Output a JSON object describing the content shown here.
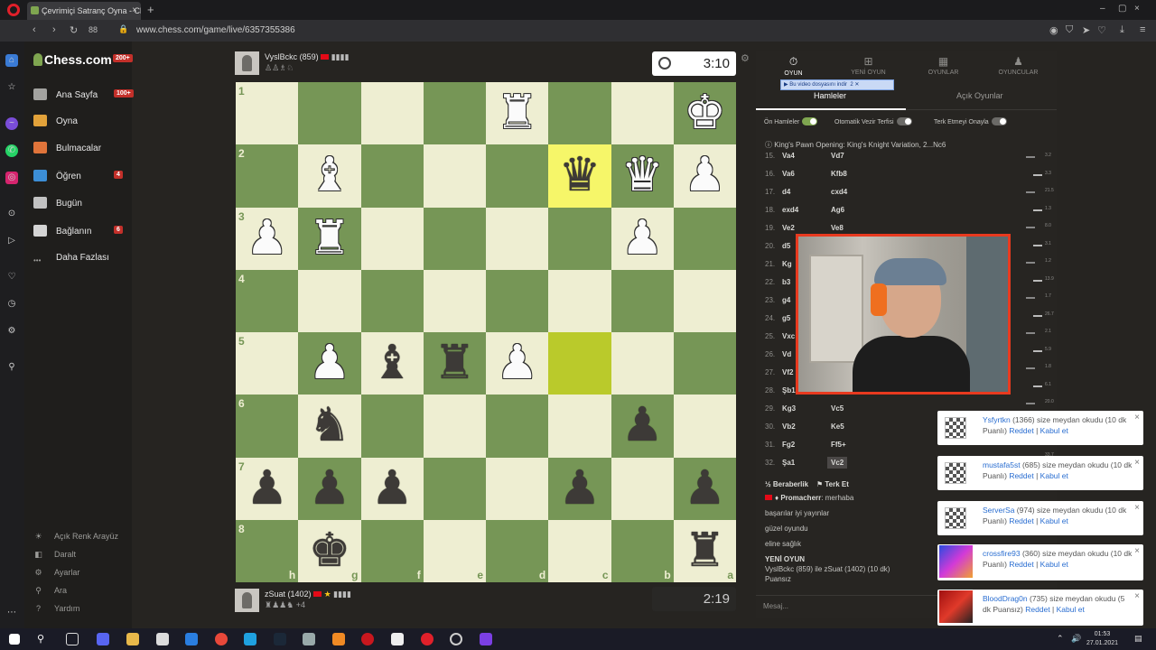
{
  "browser": {
    "tab_title": "Çevrimiçi Satranç Oyna - Ch",
    "tab_close": "×",
    "new_tab": "+",
    "url": "www.chess.com/game/live/6357355386",
    "speed_dial_count": "88",
    "window_controls": [
      "–",
      "▢",
      "×"
    ]
  },
  "sidebar": {
    "logo": "Chess.com",
    "logo_badge": "200+",
    "items": [
      {
        "label": "Ana Sayfa",
        "badge": "100+",
        "icon": "home-icon",
        "color": "#a3a3a0"
      },
      {
        "label": "Oyna",
        "badge": "",
        "icon": "pawn-play-icon",
        "color": "#e2a23a"
      },
      {
        "label": "Bulmacalar",
        "badge": "",
        "icon": "puzzle-icon",
        "color": "#e0743a"
      },
      {
        "label": "Öğren",
        "badge": "4",
        "icon": "learn-icon",
        "color": "#3c8ed6"
      },
      {
        "label": "Bugün",
        "badge": "",
        "icon": "news-icon",
        "color": "#c2c2c2"
      },
      {
        "label": "Bağlanın",
        "badge": "6",
        "icon": "community-icon",
        "color": "#d4d4d4"
      },
      {
        "label": "Daha Fazlası",
        "badge": "",
        "icon": "more-dots-icon",
        "color": "#9b9b98"
      }
    ],
    "bottom": [
      {
        "label": "Açık Renk Arayüz",
        "icon": "sun-icon",
        "glyph": "☀"
      },
      {
        "label": "Daralt",
        "icon": "collapse-icon",
        "glyph": "◧"
      },
      {
        "label": "Ayarlar",
        "icon": "settings-icon",
        "glyph": "⚙"
      },
      {
        "label": "Ara",
        "icon": "search-icon",
        "glyph": "⚲"
      },
      {
        "label": "Yardım",
        "icon": "help-icon",
        "glyph": "?"
      }
    ]
  },
  "top_player": {
    "name": "VyslBckc (859)",
    "clock": "3:10"
  },
  "bottom_player": {
    "name": "zSuat (1402)",
    "sub": "+4",
    "clock": "2:19"
  },
  "board": {
    "ranks": [
      "1",
      "2",
      "3",
      "4",
      "5",
      "6",
      "7",
      "8"
    ],
    "files": [
      "h",
      "g",
      "f",
      "e",
      "d",
      "c",
      "b",
      "a"
    ],
    "rows": [
      [
        "",
        "",
        "",
        "",
        "wR",
        "",
        "",
        "wK"
      ],
      [
        "",
        "wB",
        "",
        "",
        "",
        "bQ",
        "wQ",
        "wP"
      ],
      [
        "wP",
        "wR",
        "",
        "",
        "",
        "",
        "wP",
        ""
      ],
      [
        "",
        "",
        "",
        "",
        "",
        "",
        "",
        ""
      ],
      [
        "",
        "wP",
        "bB",
        "bR",
        "wP",
        "",
        "",
        ""
      ],
      [
        "",
        "bN",
        "",
        "",
        "",
        "",
        "bP",
        ""
      ],
      [
        "bP",
        "bP",
        "bP",
        "",
        "",
        "bP",
        "",
        "bP"
      ],
      [
        "",
        "bK",
        "",
        "",
        "",
        "",
        "",
        "bR"
      ]
    ],
    "highlight_last_to": [
      1,
      5
    ],
    "highlight_last_from": [
      4,
      5
    ]
  },
  "panel": {
    "tabs": [
      {
        "label": "OYUN",
        "icon": "stopwatch-icon",
        "glyph": "⏱"
      },
      {
        "label": "YENİ OYUN",
        "icon": "plus-board-icon",
        "glyph": "⊞"
      },
      {
        "label": "OYUNLAR",
        "icon": "board-icon",
        "glyph": "▦"
      },
      {
        "label": "OYUNCULAR",
        "icon": "players-icon",
        "glyph": "♟"
      }
    ],
    "subtabs": [
      "Hamleler",
      "Açık Oyunlar"
    ],
    "download_bar": "Bu video dosyasını indir",
    "download_counter": "2",
    "options": [
      {
        "label": "Ön Hamleler",
        "on": true
      },
      {
        "label": "Otomatik Vezir Terfisi",
        "on": false
      },
      {
        "label": "Terk Etmeyi Onayla",
        "on": false
      }
    ],
    "opening": "King's Pawn Opening: King's Knight Variation, 2...Nc6",
    "moves": [
      {
        "n": "15.",
        "w": "Va4",
        "b": "Vd7"
      },
      {
        "n": "16.",
        "w": "Va6",
        "b": "Kfb8"
      },
      {
        "n": "17.",
        "w": "d4",
        "b": "cxd4"
      },
      {
        "n": "18.",
        "w": "exd4",
        "b": "Ag6"
      },
      {
        "n": "19.",
        "w": "Ve2",
        "b": "Ve8"
      },
      {
        "n": "20.",
        "w": "d5",
        "b": ""
      },
      {
        "n": "21.",
        "w": "Kg",
        "b": ""
      },
      {
        "n": "22.",
        "w": "b3",
        "b": ""
      },
      {
        "n": "23.",
        "w": "g4",
        "b": ""
      },
      {
        "n": "24.",
        "w": "g5",
        "b": ""
      },
      {
        "n": "25.",
        "w": "Vxc",
        "b": ""
      },
      {
        "n": "26.",
        "w": "Vd",
        "b": ""
      },
      {
        "n": "27.",
        "w": "Vf2",
        "b": ""
      },
      {
        "n": "28.",
        "w": "Şb1",
        "b": ""
      },
      {
        "n": "29.",
        "w": "Kg3",
        "b": "Vc5"
      },
      {
        "n": "30.",
        "w": "Vb2",
        "b": "Ke5"
      },
      {
        "n": "31.",
        "w": "Fg2",
        "b": "Ff5+"
      },
      {
        "n": "32.",
        "w": "Şa1",
        "b": "Vc2"
      }
    ],
    "time_ticks": [
      "3.2",
      "3.3",
      "21.5",
      "1.3",
      "8.0",
      "3.1",
      "1.2",
      "13.9",
      "1.7",
      "26.7",
      "2.1",
      "5.9",
      "1.8",
      "6.1",
      "20.0",
      "17.8",
      "6.8",
      "33.7"
    ],
    "draw_label": "Beraberlik",
    "resign_label": "Terk Et",
    "chat": [
      {
        "user": "Promacherr",
        "text": "merhaba"
      },
      {
        "user": "",
        "text": "başarılar iyi yayınlar"
      },
      {
        "user": "",
        "text": "güzel oyundu"
      },
      {
        "user": "",
        "text": "eline sağlık"
      }
    ],
    "new_game_title": "YENİ OYUN",
    "new_game_text": "VyslBckc (859) ile zSuat (1402) (10 dk)",
    "new_game_sub": "Puansız",
    "message_placeholder": "Mesaj..."
  },
  "notifications": [
    {
      "user": "Ysfyrtkn",
      "rest": " (1366) size meydan okudu (10 dk Puanlı)",
      "decline": "Reddet",
      "accept": "Kabul et",
      "avatar": "checker"
    },
    {
      "user": "mustafa5st",
      "rest": " (685) size meydan okudu (10 dk Puanlı)",
      "decline": "Reddet",
      "accept": "Kabul et",
      "avatar": "checker"
    },
    {
      "user": "ServerSa",
      "rest": " (974) size meydan okudu (10 dk Puanlı)",
      "decline": "Reddet",
      "accept": "Kabul et",
      "avatar": "checker"
    },
    {
      "user": "crossfire93",
      "rest": " (360) size meydan okudu (10 dk Puanlı)",
      "decline": "Reddet",
      "accept": "Kabul et",
      "avatar": "image-blue"
    },
    {
      "user": "BloodDrag0n",
      "rest": " (735) size meydan okudu (5 dk Puansız)",
      "decline": "Reddet",
      "accept": "Kabul et",
      "avatar": "image-red"
    }
  ],
  "taskbar": {
    "time": "01:53",
    "date": "27.01.2021"
  }
}
